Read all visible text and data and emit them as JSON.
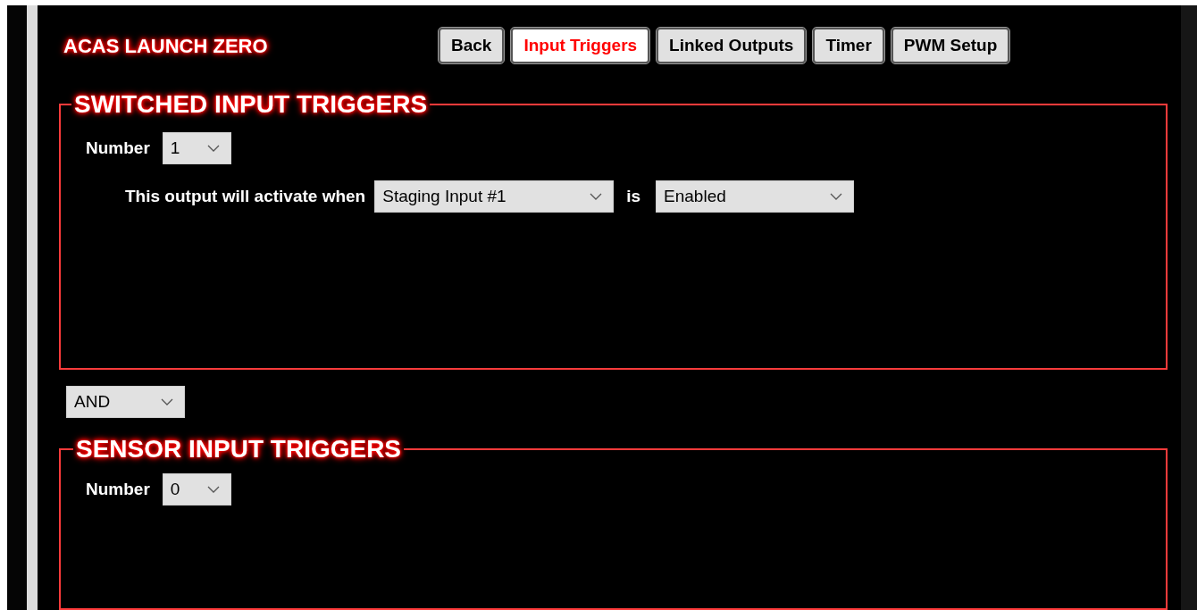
{
  "title": "ACAS LAUNCH ZERO",
  "tabs": [
    {
      "label": "Back",
      "selected": false
    },
    {
      "label": "Input Triggers",
      "selected": true
    },
    {
      "label": "Linked Outputs",
      "selected": false
    },
    {
      "label": "Timer",
      "selected": false
    },
    {
      "label": "PWM Setup",
      "selected": false
    }
  ],
  "switched": {
    "title": "SWITCHED INPUT TRIGGERS",
    "number_label": "Number",
    "number": "1",
    "condition_label": "This output will activate when",
    "input": "Staging Input #1",
    "is_label": "is",
    "state": "Enabled"
  },
  "logic": "AND",
  "sensor": {
    "title": "SENSOR INPUT TRIGGERS",
    "number_label": "Number",
    "number": "0"
  }
}
